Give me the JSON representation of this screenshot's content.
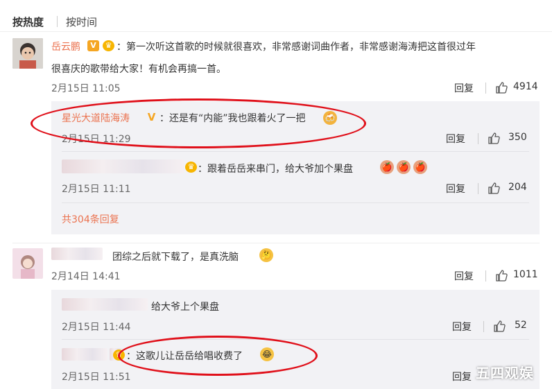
{
  "sort_tabs": {
    "hot": "按热度",
    "time": "按时间"
  },
  "comments": [
    {
      "user": "岳云鹏",
      "text_line1": "：第一次听这首歌的时候就很喜欢，非常感谢词曲作者，非常感谢海涛把这首很过年",
      "text_line2": "很喜庆的歌带给大家！有机会再搞一首。",
      "time": "2月15日 11:05",
      "reply_label": "回复",
      "likes": "4914",
      "replies": [
        {
          "user": "星光大道陆海涛",
          "text": "：还是有“内能”我也跟着火了一把",
          "time": "2月15日 11:29",
          "reply_label": "回复",
          "likes": "350"
        },
        {
          "user": "",
          "text": "：跟着岳岳来串门，给大爷加个果盘",
          "time": "2月15日 11:11",
          "reply_label": "回复",
          "likes": "204"
        }
      ],
      "more_replies": "共304条回复"
    },
    {
      "user": "",
      "text": "团综之后就下载了，是真洗脑",
      "time": "2月14日 14:41",
      "reply_label": "回复",
      "likes": "1011",
      "replies": [
        {
          "user": "",
          "text": "给大爷上个果盘",
          "time": "2月15日 11:44",
          "reply_label": "回复",
          "likes": "52"
        },
        {
          "user": "",
          "text": "：这歌儿让岳岳给唱收费了",
          "time": "2月15日 11:51",
          "reply_label": "回复",
          "likes": ""
        }
      ]
    }
  ],
  "watermark": "五四观娱",
  "colors": {
    "username": "#eb7350",
    "annotation_oval": "#e0101a",
    "reply_box": "#f2f2f5"
  }
}
